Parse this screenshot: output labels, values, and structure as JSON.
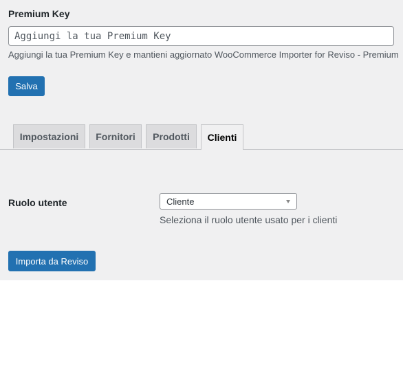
{
  "premium": {
    "label": "Premium Key",
    "placeholder": "Aggiungi la tua Premium Key",
    "value": "",
    "description": "Aggiungi la tua Premium Key e mantieni aggiornato WooCommerce Importer for Reviso - Premium",
    "save_label": "Salva"
  },
  "tabs": [
    {
      "label": "Impostazioni",
      "active": false
    },
    {
      "label": "Fornitori",
      "active": false
    },
    {
      "label": "Prodotti",
      "active": false
    },
    {
      "label": "Clienti",
      "active": true
    }
  ],
  "user_role": {
    "label": "Ruolo utente",
    "selected": "Cliente",
    "description": "Seleziona il ruolo utente usato per i clienti"
  },
  "import_label": "Importa da Reviso",
  "colors": {
    "primary_button": "#2271b1",
    "panel_background": "#f0f0f1"
  }
}
